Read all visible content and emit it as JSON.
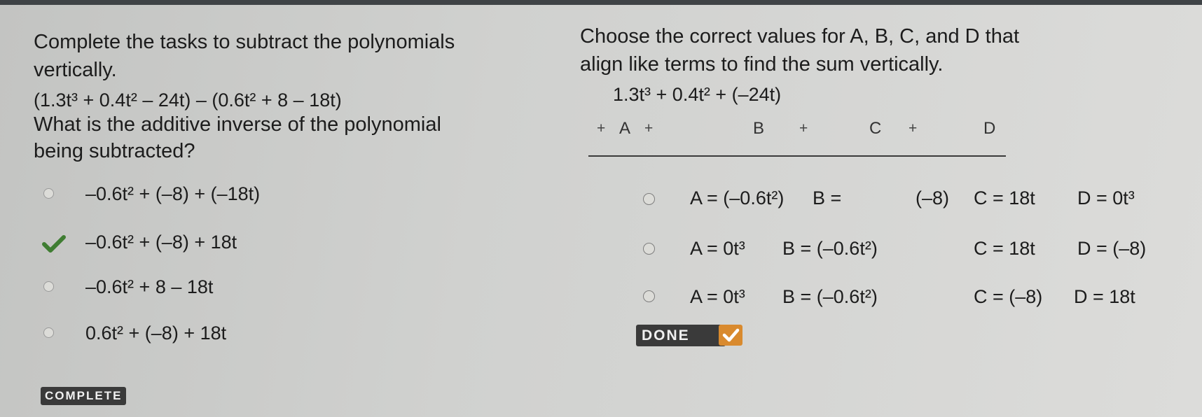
{
  "left": {
    "instruction_line1": "Complete the tasks to subtract the polynomials",
    "instruction_line2": "vertically.",
    "expression": "(1.3t³ + 0.4t² – 24t) – (0.6t² + 8 – 18t)",
    "question_line1": "What is the additive inverse of the polynomial",
    "question_line2": "being subtracted?",
    "options": [
      "–0.6t² + (–8) + (–18t)",
      "–0.6t² + (–8) + 18t",
      "–0.6t² + 8 – 18t",
      "0.6t² + (–8) + 18t"
    ],
    "selected_index": 1,
    "complete_label": "COMPLETE"
  },
  "right": {
    "instruction_line1": "Choose the correct values for A, B, C, and D that",
    "instruction_line2": "align like terms to find the sum vertically.",
    "sum_top": "1.3t³ + 0.4t² + (–24t)",
    "sum_row": {
      "plus": "+",
      "a": "A",
      "b": "B",
      "c": "C",
      "d": "D"
    },
    "options": [
      {
        "a": "A = (–0.6t²)",
        "b": "B =",
        "b_val": "(–8)",
        "c": "C = 18t",
        "d": "D = 0t³"
      },
      {
        "a": "A = 0t³",
        "b": "B = (–0.6t²)",
        "c": "C = 18t",
        "d": "D = (–8)"
      },
      {
        "a": "A = 0t³",
        "b": "B = (–0.6t²)",
        "c": "C = (–8)",
        "d": "D = 18t"
      }
    ],
    "done_label": "DONE"
  },
  "colors": {
    "check_green": "#3f7d32",
    "done_accent": "#d98a2e",
    "badge_bg": "#3a3a3a"
  }
}
